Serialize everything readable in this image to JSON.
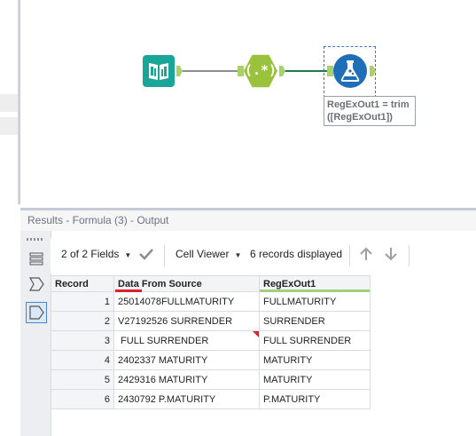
{
  "canvas": {
    "annotation": {
      "line1": "RegExOut1 = trim",
      "line2": "([RegExOut1])"
    },
    "tools": {
      "input": {
        "icon": "book-input-icon"
      },
      "regex": {
        "icon": "regex-icon",
        "glyph": "(.*)"
      },
      "formula": {
        "icon": "flask-icon"
      }
    },
    "colors": {
      "input": "#1aa599",
      "regex": "#9bc23c",
      "formula": "#1e6fb8",
      "anchor": "#a9d26a"
    }
  },
  "results": {
    "title": "Results - Formula (3) - Output",
    "toolbar": {
      "fields_label": "2 of 2 Fields",
      "viewer_label": "Cell Viewer",
      "records_label": "6 records displayed"
    },
    "table": {
      "columns": [
        "Record",
        "Data From Source",
        "RegExOut1"
      ],
      "rows": [
        {
          "record": "1",
          "source": "25014078FULLMATURITY",
          "out": "FULLMATURITY"
        },
        {
          "record": "2",
          "source": "V27192526 SURRENDER",
          "out": "SURRENDER"
        },
        {
          "record": "3",
          "source": " FULL SURRENDER",
          "out": "FULL SURRENDER"
        },
        {
          "record": "4",
          "source": "2402337 MATURITY",
          "out": "MATURITY"
        },
        {
          "record": "5",
          "source": "2429316 MATURITY",
          "out": "MATURITY"
        },
        {
          "record": "6",
          "source": "2430792 P.MATURITY",
          "out": "P.MATURITY"
        }
      ]
    }
  }
}
